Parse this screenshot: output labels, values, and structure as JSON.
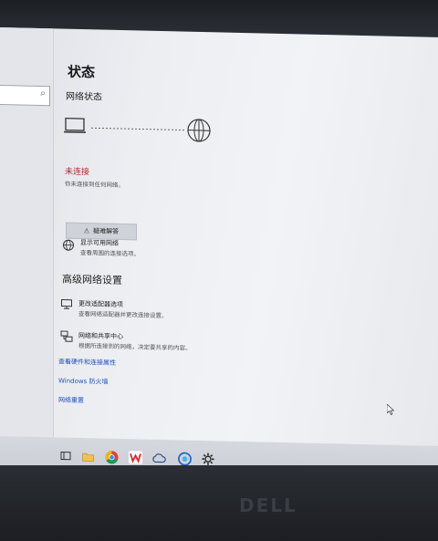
{
  "left_pane": {
    "search_icon": "search-icon"
  },
  "main": {
    "title": "状态",
    "network_status_heading": "网络状态",
    "not_connected": "未连接",
    "not_connected_desc": "你未连接到任何网络。",
    "troubleshoot_label": "疑难解答",
    "available_networks": {
      "label": "显示可用网络",
      "desc": "查看周围的连接选项。"
    },
    "advanced_heading": "高级网络设置",
    "adapter_options": {
      "label": "更改适配器选项",
      "desc": "查看网络适配器并更改连接设置。"
    },
    "sharing_center": {
      "label": "网络和共享中心",
      "desc": "根据所连接到的网络，决定要共享的内容。"
    },
    "links": [
      "查看硬件和连接属性",
      "Windows 防火墙",
      "网络重置"
    ]
  },
  "taskbar": {
    "icons": [
      "task-view-icon",
      "file-explorer-icon",
      "chrome-icon",
      "wps-icon",
      "cloud-icon",
      "edge-icon",
      "settings-icon"
    ]
  },
  "bezel": {
    "brand": "DELL"
  },
  "colors": {
    "link": "#2054b8",
    "error": "#b2232a",
    "background": "#eceef2"
  }
}
